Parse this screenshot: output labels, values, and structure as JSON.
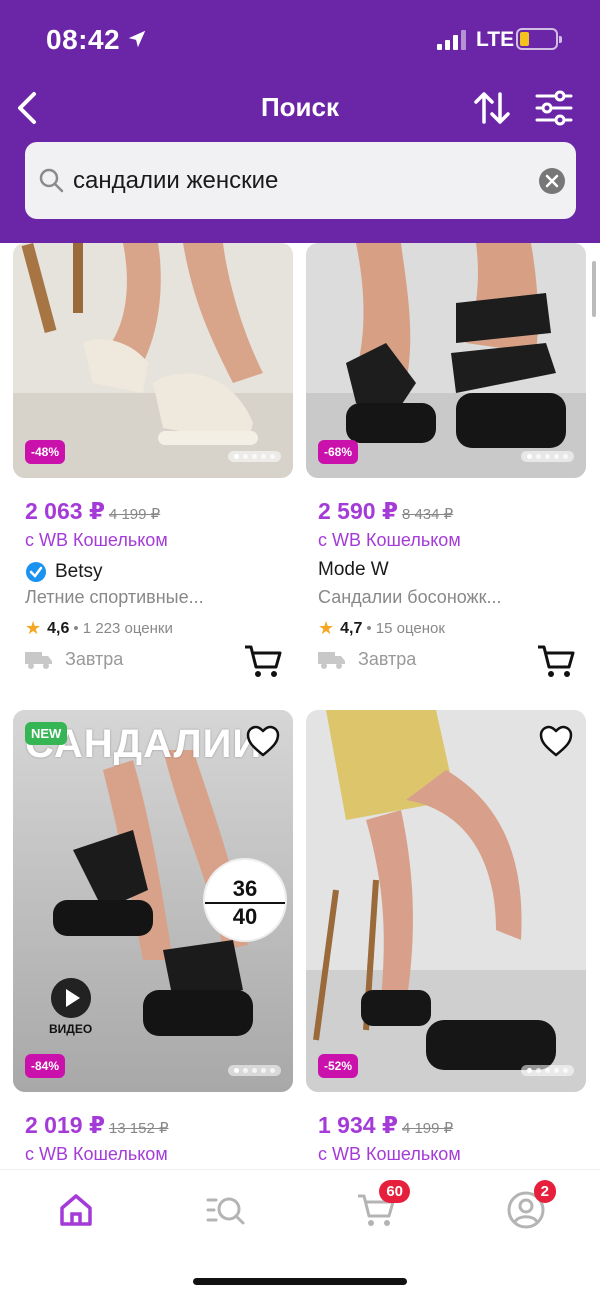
{
  "status_bar": {
    "time": "08:42",
    "network": "LTE"
  },
  "nav": {
    "title": "Поиск"
  },
  "search": {
    "query": "сандалии женские"
  },
  "products": [
    {
      "price": "2 063 ₽",
      "old_price": "4 199 ₽",
      "wallet": "с WB Кошельком",
      "brand": "Betsy",
      "verified": true,
      "title": "Летние спортивные...",
      "rating": "4,6",
      "reviews": "• 1 223 оценки",
      "delivery": "Завтра",
      "discount": "-48%"
    },
    {
      "price": "2 590 ₽",
      "old_price": "8 434 ₽",
      "wallet": "с WB Кошельком",
      "brand": "Mode W",
      "verified": false,
      "title": "Сандалии босоножк...",
      "rating": "4,7",
      "reviews": "• 15 оценок",
      "delivery": "Завтра",
      "discount": "-68%"
    },
    {
      "price": "2 019 ₽",
      "old_price": "13 152 ₽",
      "wallet": "с WB Кошельком",
      "discount": "-84%",
      "badge": "NEW",
      "caption": "САНДАЛИИ",
      "video_label": "ВИДЕО",
      "size_top": "36",
      "size_bottom": "40"
    },
    {
      "price": "1 934 ₽",
      "old_price": "4 199 ₽",
      "wallet": "с WB Кошельком",
      "discount": "-52%"
    }
  ],
  "tabbar": {
    "cart_count": "60",
    "profile_count": "2"
  },
  "colors": {
    "header": "#6a26a6",
    "accent": "#a43bd9",
    "discount": "#cb11ab",
    "badge": "#e6203c"
  },
  "icons": [
    "location-arrow-icon",
    "back-icon",
    "sort-icon",
    "filter-icon",
    "search-icon",
    "clear-icon",
    "heart-icon",
    "cart-icon",
    "truck-icon",
    "home-icon",
    "catalog-search-icon",
    "profile-icon",
    "play-icon",
    "verified-icon",
    "star-icon"
  ]
}
